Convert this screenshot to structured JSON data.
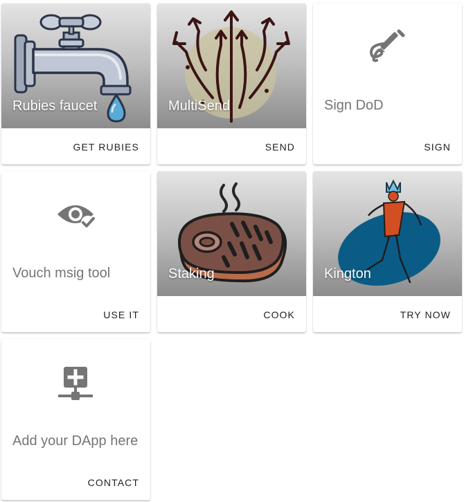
{
  "cards": [
    {
      "title": "Rubies faucet",
      "action": "GET RUBIES",
      "icon": "faucet-icon"
    },
    {
      "title": "MultiSend",
      "action": "SEND",
      "icon": "multisend-arrows-icon"
    },
    {
      "title": "Sign DoD",
      "action": "SIGN",
      "icon": "signature-pen-icon"
    },
    {
      "title": "Vouch msig tool",
      "action": "USE IT",
      "icon": "eye-check-icon"
    },
    {
      "title": "Staking",
      "action": "COOK",
      "icon": "steak-icon"
    },
    {
      "title": "Kington",
      "action": "TRY NOW",
      "icon": "king-figure-icon"
    },
    {
      "title": "Add your DApp here",
      "action": "CONTACT",
      "icon": "add-network-icon"
    }
  ],
  "colors": {
    "title_light": "#ffffff",
    "title_muted": "#757575",
    "action_text": "#212121",
    "icon_grey": "#757575"
  }
}
